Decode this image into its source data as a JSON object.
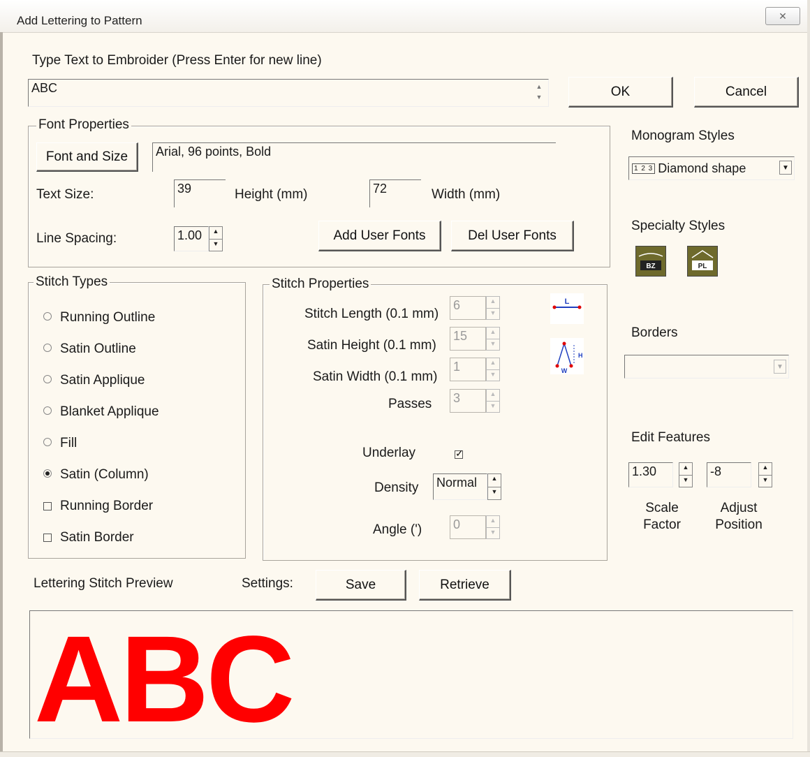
{
  "window": {
    "title": "Add Lettering to Pattern",
    "close_label": "✕"
  },
  "text_entry": {
    "label": "Type Text to Embroider (Press Enter for new line)",
    "value": "ABC"
  },
  "buttons": {
    "ok": "OK",
    "cancel": "Cancel"
  },
  "font_properties": {
    "group_title": "Font Properties",
    "font_button": "Font and Size",
    "font_display": "Arial, 96 points, Bold",
    "text_size_label": "Text Size:",
    "height_value": "39",
    "height_label": "Height (mm)",
    "width_value": "72",
    "width_label": "Width (mm)",
    "line_spacing_label": "Line Spacing:",
    "line_spacing_value": "1.00",
    "add_fonts_button": "Add User Fonts",
    "del_fonts_button": "Del User Fonts"
  },
  "stitch_types": {
    "group_title": "Stitch Types",
    "options": [
      {
        "label": "Running Outline",
        "kind": "radio",
        "selected": false
      },
      {
        "label": "Satin Outline",
        "kind": "radio",
        "selected": false
      },
      {
        "label": "Satin Applique",
        "kind": "radio",
        "selected": false
      },
      {
        "label": "Blanket Applique",
        "kind": "radio",
        "selected": false
      },
      {
        "label": "Fill",
        "kind": "radio",
        "selected": false
      },
      {
        "label": "Satin (Column)",
        "kind": "radio",
        "selected": true
      },
      {
        "label": "Running Border",
        "kind": "checkbox",
        "selected": false
      },
      {
        "label": "Satin Border",
        "kind": "checkbox",
        "selected": false
      }
    ]
  },
  "stitch_properties": {
    "group_title": "Stitch Properties",
    "stitch_length_label": "Stitch Length (0.1 mm)",
    "stitch_length_value": "6",
    "satin_height_label": "Satin Height (0.1 mm)",
    "satin_height_value": "15",
    "satin_width_label": "Satin Width (0.1 mm)",
    "satin_width_value": "1",
    "passes_label": "Passes",
    "passes_value": "3",
    "underlay_label": "Underlay",
    "underlay_checked": true,
    "density_label": "Density",
    "density_value": "Normal",
    "angle_label": "Angle (')",
    "angle_value": "0",
    "length_icon_text": "L",
    "height_icon_text": "H",
    "width_icon_text": "W"
  },
  "monogram": {
    "label": "Monogram Styles",
    "selected": "Diamond shape",
    "icon_glyph": "1 2 3"
  },
  "specialty": {
    "label": "Specialty Styles",
    "tile1_text": "BZ",
    "tile2_text": "PL"
  },
  "borders": {
    "label": "Borders",
    "selected": ""
  },
  "edit_features": {
    "label": "Edit Features",
    "scale_value": "1.30",
    "scale_label_1": "Scale",
    "scale_label_2": "Factor",
    "adjust_value": "-8",
    "adjust_label_1": "Adjust",
    "adjust_label_2": "Position"
  },
  "preview": {
    "label": "Lettering Stitch Preview",
    "settings_label": "Settings:",
    "save_button": "Save",
    "retrieve_button": "Retrieve",
    "preview_text": "ABC",
    "preview_color": "#ff0000"
  },
  "colors": {
    "dialog_bg": "#fdf9f0",
    "icon_tile": "#6e6a2c",
    "stitch_point": "#e00000",
    "stitch_line": "#2040c0"
  }
}
